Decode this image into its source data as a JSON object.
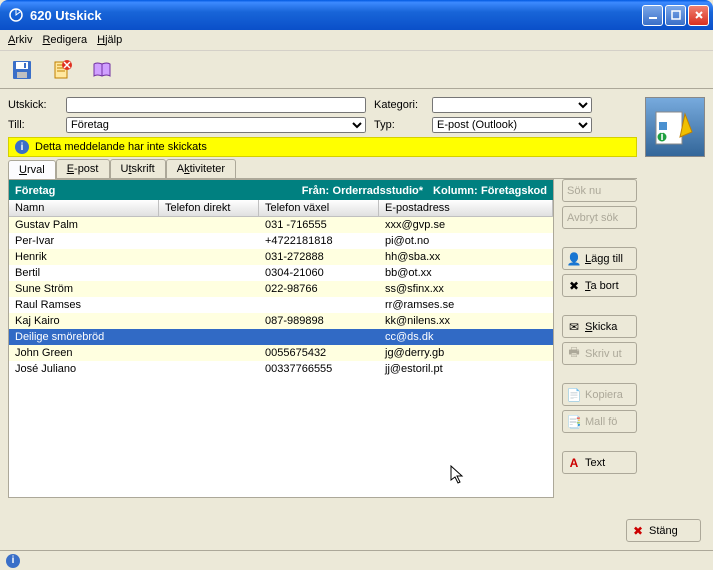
{
  "window": {
    "title": "620 Utskick"
  },
  "menu": {
    "arkiv": "Arkiv",
    "redigera": "Redigera",
    "hjalp": "Hjälp"
  },
  "form": {
    "utskick_label": "Utskick:",
    "utskick_value": "",
    "kategori_label": "Kategori:",
    "kategori_value": "",
    "till_label": "Till:",
    "till_value": "Företag",
    "typ_label": "Typ:",
    "typ_value": "E-post (Outlook)"
  },
  "warning": "Detta meddelande har inte skickats",
  "tabs": {
    "urval": "Urval",
    "epost": "E-post",
    "utskrift": "Utskrift",
    "aktiviteter": "Aktiviteter"
  },
  "grid": {
    "title": "Företag",
    "from_label": "Från:",
    "from_value": "Orderradsstudio*",
    "kolumn_label": "Kolumn:",
    "kolumn_value": "Företagskod",
    "headers": {
      "namn": "Namn",
      "tel_direkt": "Telefon direkt",
      "tel_vaxel": "Telefon växel",
      "epost": "E-postadress"
    },
    "rows": [
      {
        "namn": "Gustav Palm",
        "td": "",
        "tv": "031 -716555",
        "ep": "xxx@gvp.se"
      },
      {
        "namn": "Per-Ivar",
        "td": "",
        "tv": "+4722181818",
        "ep": "pi@ot.no"
      },
      {
        "namn": "Henrik",
        "td": "",
        "tv": "031-272888",
        "ep": "hh@sba.xx"
      },
      {
        "namn": "Bertil",
        "td": "",
        "tv": "0304-21060",
        "ep": "bb@ot.xx"
      },
      {
        "namn": "Sune Ström",
        "td": "",
        "tv": "022-98766",
        "ep": "ss@sfinx.xx"
      },
      {
        "namn": "Raul Ramses",
        "td": "",
        "tv": "",
        "ep": "rr@ramses.se"
      },
      {
        "namn": "Kaj Kairo",
        "td": "",
        "tv": "087-989898",
        "ep": "kk@nilens.xx"
      },
      {
        "namn": "Deilige smörebröd",
        "td": "",
        "tv": "",
        "ep": "cc@ds.dk"
      },
      {
        "namn": "John Green",
        "td": "",
        "tv": "0055675432",
        "ep": "jg@derry.gb"
      },
      {
        "namn": "José Juliano",
        "td": "",
        "tv": "00337766555",
        "ep": "jj@estoril.pt"
      }
    ],
    "selected_index": 7
  },
  "buttons": {
    "sok_nu": "Sök nu",
    "avbryt": "Avbryt sök",
    "lagg_till": "Lägg till",
    "ta_bort": "Ta bort",
    "skicka": "Skicka",
    "skriv_ut": "Skriv ut",
    "kopiera": "Kopiera",
    "mall_fo": "Mall fö",
    "text": "Text",
    "stang": "Stäng"
  }
}
